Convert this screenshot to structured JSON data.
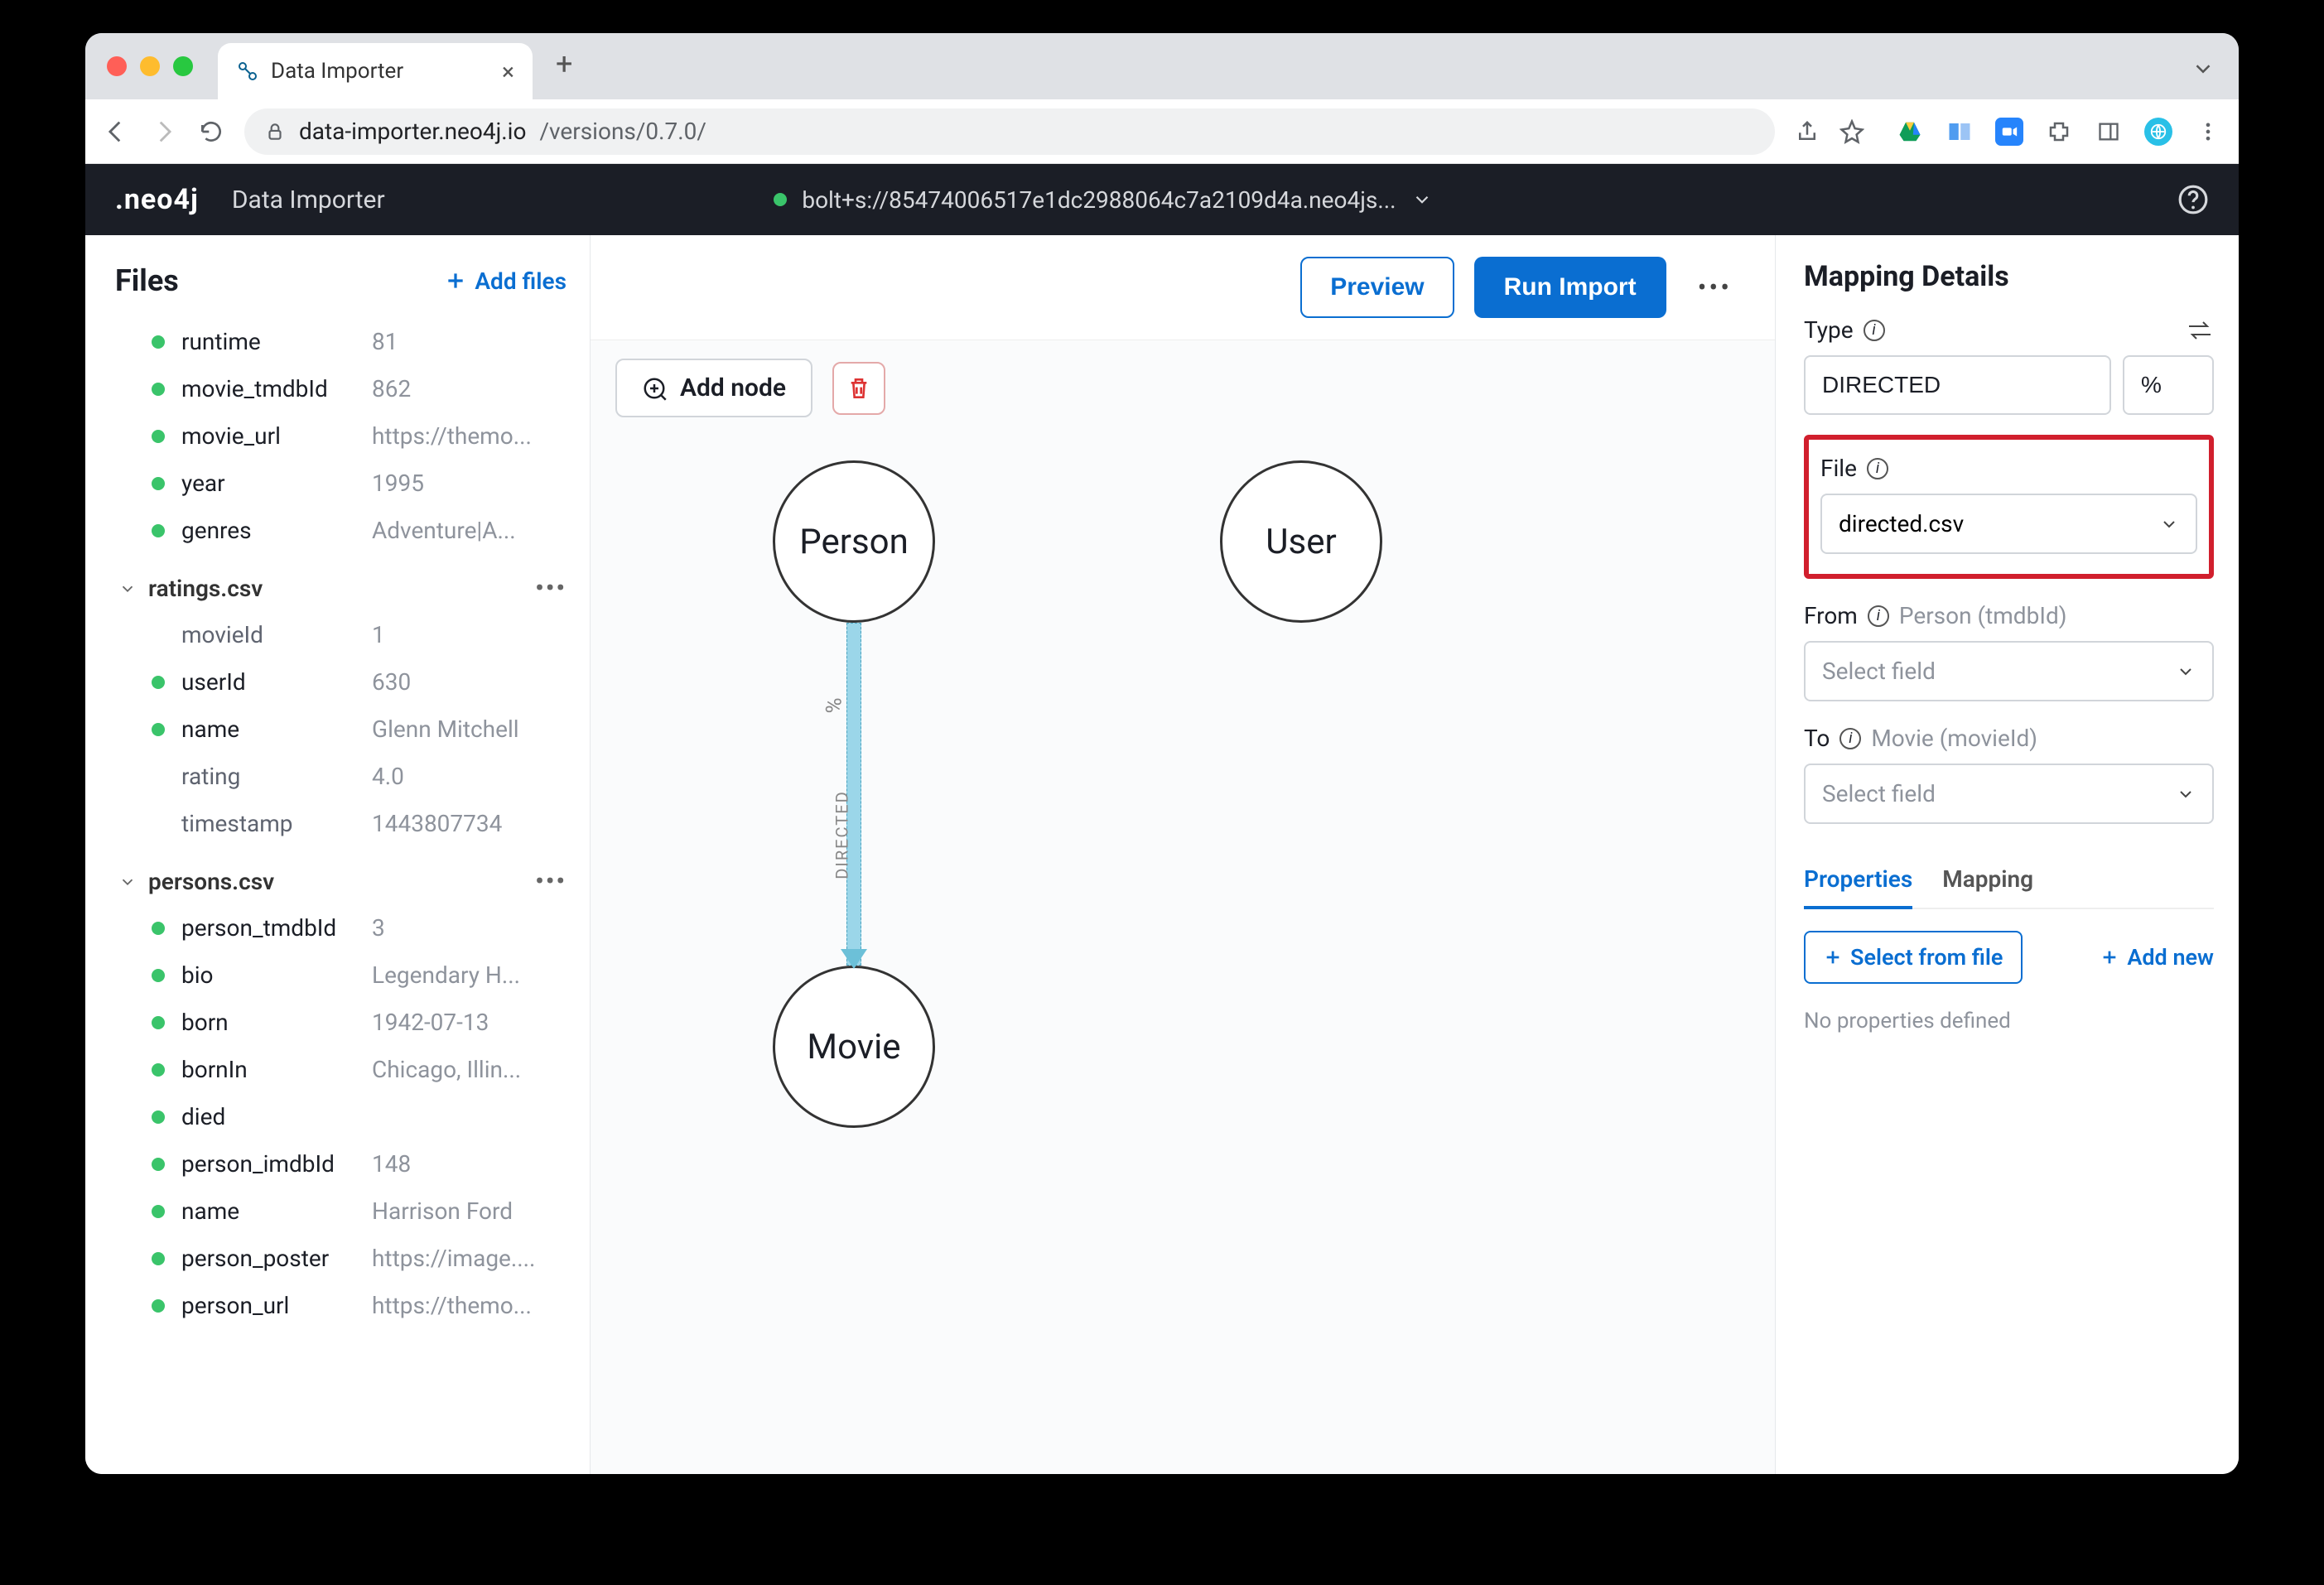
{
  "browser": {
    "tab_title": "Data Importer",
    "url_host": "data-importer.neo4j.io",
    "url_path": "/versions/0.7.0/"
  },
  "app": {
    "logo": ".neo4j",
    "title": "Data Importer",
    "connection": "bolt+s://85474006517e1dc2988064c7a2109d4a.neo4js..."
  },
  "sidebar": {
    "title": "Files",
    "add_files": "Add files",
    "orphan_fields": [
      {
        "name": "runtime",
        "value": "81",
        "dot": true
      },
      {
        "name": "movie_tmdbId",
        "value": "862",
        "dot": true
      },
      {
        "name": "movie_url",
        "value": "https://themo...",
        "dot": true
      },
      {
        "name": "year",
        "value": "1995",
        "dot": true
      },
      {
        "name": "genres",
        "value": "Adventure|A...",
        "dot": true
      }
    ],
    "groups": [
      {
        "file": "ratings.csv",
        "fields": [
          {
            "name": "movieId",
            "value": "1",
            "dot": false
          },
          {
            "name": "userId",
            "value": "630",
            "dot": true
          },
          {
            "name": "name",
            "value": "Glenn Mitchell",
            "dot": true
          },
          {
            "name": "rating",
            "value": "4.0",
            "dot": false
          },
          {
            "name": "timestamp",
            "value": "1443807734",
            "dot": false
          }
        ]
      },
      {
        "file": "persons.csv",
        "fields": [
          {
            "name": "person_tmdbId",
            "value": "3",
            "dot": true
          },
          {
            "name": "bio",
            "value": "Legendary H...",
            "dot": true
          },
          {
            "name": "born",
            "value": "1942-07-13",
            "dot": true
          },
          {
            "name": "bornIn",
            "value": "Chicago, Illin...",
            "dot": true
          },
          {
            "name": "died",
            "value": "",
            "dot": true
          },
          {
            "name": "person_imdbId",
            "value": "148",
            "dot": true
          },
          {
            "name": "name",
            "value": "Harrison Ford",
            "dot": true
          },
          {
            "name": "person_poster",
            "value": "https://image....",
            "dot": true
          },
          {
            "name": "person_url",
            "value": "https://themo...",
            "dot": true
          }
        ]
      }
    ]
  },
  "canvas": {
    "preview": "Preview",
    "run_import": "Run Import",
    "add_node": "Add node",
    "nodes": {
      "person": "Person",
      "user": "User",
      "movie": "Movie"
    },
    "rel_label": "DIRECTED",
    "rel_pct": "%"
  },
  "details": {
    "title": "Mapping Details",
    "type_label": "Type",
    "type_value": "DIRECTED",
    "type_pct": "%",
    "file_label": "File",
    "file_value": "directed.csv",
    "from_label": "From",
    "from_sub": "Person (tmdbId)",
    "from_placeholder": "Select field",
    "to_label": "To",
    "to_sub": "Movie (movieId)",
    "to_placeholder": "Select field",
    "tabs": {
      "properties": "Properties",
      "mapping": "Mapping"
    },
    "select_from_file": "Select from file",
    "add_new": "Add new",
    "empty": "No properties defined"
  }
}
